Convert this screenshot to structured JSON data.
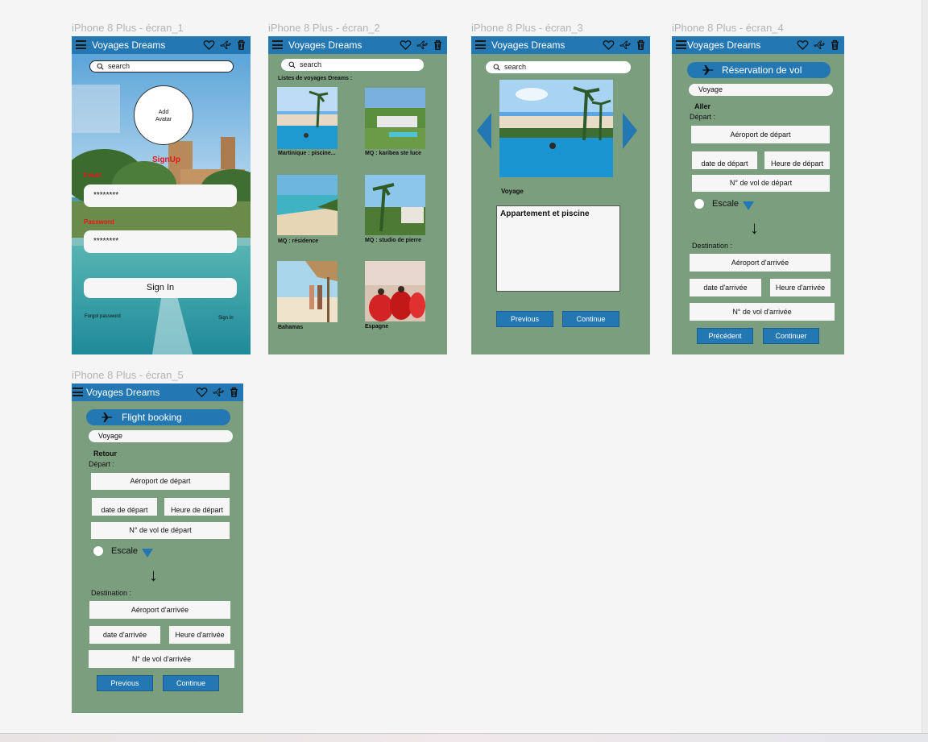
{
  "frames": [
    {
      "title": "iPhone 8 Plus  - écran_1"
    },
    {
      "title": "iPhone 8 Plus - écran_2"
    },
    {
      "title": "iPhone 8 Plus - écran_3"
    },
    {
      "title": "iPhone 8 Plus - écran_4"
    },
    {
      "title": "iPhone 8 Plus - écran_5"
    }
  ],
  "app": {
    "name": "Voyages Dreams",
    "icons": [
      "menu-icon",
      "heart-icon",
      "airplane-icon",
      "trash-icon"
    ],
    "colors": {
      "topbar": "#2377b3",
      "background": "#7a9e7e",
      "field": "#f6f6f6",
      "accent": "#2377b3",
      "error": "#ff0000"
    }
  },
  "screen1": {
    "search_placeholder": "search",
    "avatar_label": "Add Avatar",
    "signup_label": "SignUp",
    "email_label": "Email",
    "email_value": "********",
    "password_label": "Password",
    "password_value": "********",
    "signin_button": "Sign In",
    "forgot_password": "Forgot password",
    "signin_link": "Sign In"
  },
  "screen2": {
    "search_placeholder": "search",
    "list_title": "Listes de voyages Dreams :",
    "items": [
      {
        "caption": "Martinique : piscine...",
        "image": "pool-photo"
      },
      {
        "caption": "MQ : karibea ste luce",
        "image": "resort-photo"
      },
      {
        "caption": "MQ : résidence",
        "image": "beach-photo"
      },
      {
        "caption": "MQ : studio de pierre",
        "image": "palms-photo"
      },
      {
        "caption": "Bahamas",
        "image": "couple-beach-photo"
      },
      {
        "caption": "Espagne",
        "image": "dancers-photo"
      }
    ]
  },
  "screen3": {
    "search_placeholder": "search",
    "caption": "Voyage",
    "description": "Appartement et piscine",
    "previous_button": "Previous",
    "continue_button": "Continue"
  },
  "screen4": {
    "header_button": "Réservation de vol",
    "voyage_field": "Voyage",
    "section": "Aller",
    "depart_label": "Départ :",
    "airport_depart": "Aéroport de départ",
    "date_depart": "date de départ",
    "heure_depart": "Heure de départ",
    "vol_depart": "N° de vol de départ",
    "escale": "Escale",
    "destination_label": "Destination :",
    "airport_arrivee": "Aéroport d'arrivée",
    "date_arrivee": "date d'arrivée",
    "heure_arrivee": "Heure d'arrivée",
    "vol_arrivee": "N° de vol d'arrivée",
    "previous_button": "Précédent",
    "continue_button": "Continuer"
  },
  "screen5": {
    "header_button": "Flight booking",
    "voyage_field": "Voyage",
    "section": "Retour",
    "depart_label": "Départ :",
    "airport_depart": "Aéroport de départ",
    "date_depart": "date de départ",
    "heure_depart": "Heure de départ",
    "vol_depart": "N° de vol de départ",
    "escale": "Escale",
    "destination_label": "Destination :",
    "airport_arrivee": "Aéroport d'arrivée",
    "date_arrivee": "date d'arrivée",
    "heure_arrivee": "Heure d'arrivée",
    "vol_arrivee": "N° de vol d'arrivée",
    "previous_button": "Previous",
    "continue_button": "Continue"
  }
}
